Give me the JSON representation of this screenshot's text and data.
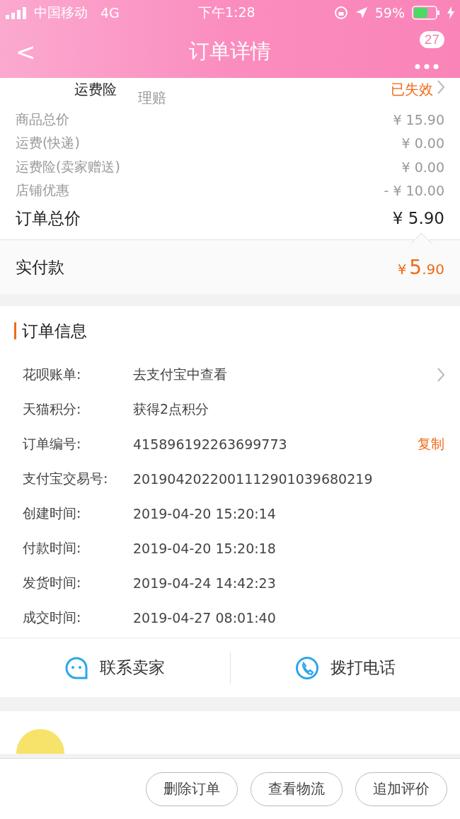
{
  "status_bar": {
    "carrier": "中国移动",
    "network": "4G",
    "time": "下午1:28",
    "battery": "59%"
  },
  "nav_bar": {
    "back": "<",
    "title": "订单详情",
    "badge": "27"
  },
  "insurance_row": {
    "label": "运费险",
    "value": "理赔",
    "status": "已失效"
  },
  "price_rows": [
    {
      "kind": "minor",
      "label": "商品总价",
      "value": "¥ 15.90"
    },
    {
      "kind": "minor",
      "label": "运费(快递)",
      "value": "¥ 0.00"
    },
    {
      "kind": "minor",
      "label": "运费险(卖家赠送)",
      "value": "¥ 0.00"
    },
    {
      "kind": "minor",
      "label": "店铺优惠",
      "value": "- ¥ 10.00"
    },
    {
      "kind": "total",
      "label": "订单总价",
      "value": "¥ 5.90"
    }
  ],
  "paid": {
    "label": "实付款",
    "currency": "¥",
    "integer": "5",
    "decimal": ".90"
  },
  "order_info": {
    "title": "订单信息",
    "rows": [
      {
        "kind": "link",
        "label": "花呗账单:",
        "value": "去支付宝中查看"
      },
      {
        "label": "天猫积分:",
        "value": "获得2点积分"
      },
      {
        "kind": "copy",
        "label": "订单编号:",
        "value": "415896192263699773",
        "action_text": "复制"
      },
      {
        "label": "支付宝交易号:",
        "value": "2019042022001112901039680219"
      },
      {
        "label": "创建时间:",
        "value": "2019-04-20 15:20:14"
      },
      {
        "label": "付款时间:",
        "value": "2019-04-20 15:20:18"
      },
      {
        "label": "发货时间:",
        "value": "2019-04-24 14:42:23"
      },
      {
        "label": "成交时间:",
        "value": "2019-04-27 08:01:40"
      }
    ]
  },
  "contact": [
    {
      "kind": "chat",
      "label": "联系卖家"
    },
    {
      "kind": "phone",
      "label": "拨打电话"
    }
  ],
  "bottom_buttons": [
    "删除订单",
    "查看物流",
    "追加评价"
  ]
}
